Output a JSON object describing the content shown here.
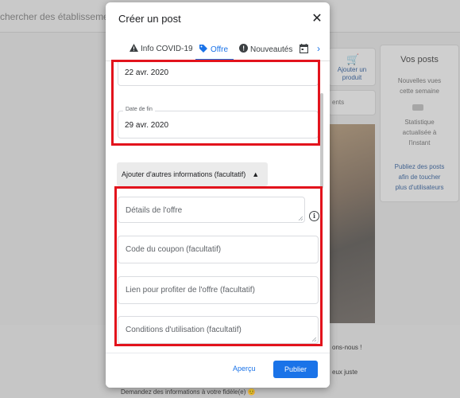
{
  "background": {
    "search_text": "chercher des établissements",
    "vos_posts": {
      "title": "Vos posts",
      "line1": "Nouvelles vues",
      "line2": "cette semaine",
      "stat1": "Statistique",
      "stat2": "actualisée à",
      "stat3": "l'instant",
      "link1": "Publiez des posts",
      "link2": "afin de toucher",
      "link3": "plus d'utilisateurs"
    },
    "add_product_label1": "Ajouter un",
    "add_product_label2": "produit",
    "ents_text": "ents",
    "frag1": "ons-nous !",
    "frag2": "eux juste",
    "frag3": "Demandez des informations à votre fidèle(e) 😊"
  },
  "modal": {
    "title": "Créer un post",
    "tabs": [
      {
        "label": "Info COVID-19",
        "icon": "warning-icon"
      },
      {
        "label": "Offre",
        "icon": "tag-icon"
      },
      {
        "label": "Nouveautés",
        "icon": "megaphone-icon"
      },
      {
        "label": "",
        "icon": "calendar-icon"
      }
    ],
    "fields": {
      "start_date_value": "22 avr. 2020",
      "end_date_label": "Date de fin",
      "end_date_value": "29 avr. 2020",
      "more_info_label": "Ajouter d'autres informations (facultatif)",
      "offer_details_placeholder": "Détails de l'offre",
      "coupon_placeholder": "Code du coupon (facultatif)",
      "link_placeholder": "Lien pour profiter de l'offre (facultatif)",
      "terms_placeholder": "Conditions d'utilisation (facultatif)"
    },
    "footer": {
      "preview_label": "Aperçu",
      "publish_label": "Publier"
    }
  },
  "colors": {
    "accent": "#1a73e8",
    "highlight": "#e2131c"
  }
}
